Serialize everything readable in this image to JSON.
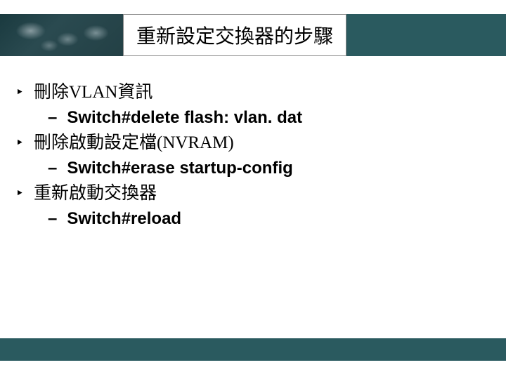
{
  "slide": {
    "title": "重新設定交換器的步驟",
    "bullets": [
      {
        "text": "刪除VLAN資訊",
        "sub": "Switch#delete flash: vlan. dat"
      },
      {
        "text": "刪除啟動設定檔(NVRAM)",
        "sub": "Switch#erase startup-config"
      },
      {
        "text": "重新啟動交換器",
        "sub": "Switch#reload"
      }
    ],
    "markers": {
      "bullet": "‣",
      "sub": "–"
    }
  }
}
